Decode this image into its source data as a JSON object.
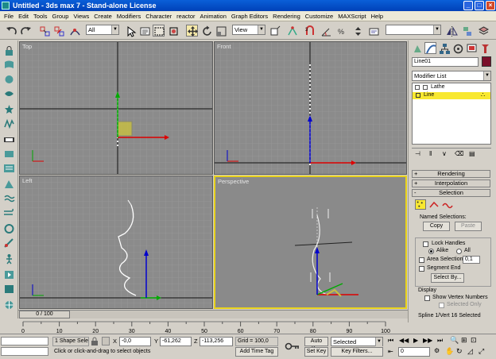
{
  "window": {
    "title": "Untitled - 3ds max 7 - Stand-alone License"
  },
  "menu": [
    "File",
    "Edit",
    "Tools",
    "Group",
    "Views",
    "Create",
    "Modifiers",
    "Character",
    "reactor",
    "Animation",
    "Graph Editors",
    "Rendering",
    "Customize",
    "MAXScript",
    "Help"
  ],
  "toolbar": {
    "selection_filter": "All",
    "reference_coord": "View"
  },
  "viewports": {
    "top": "Top",
    "front": "Front",
    "left": "Left",
    "perspective": "Perspective"
  },
  "panel": {
    "object_name": "Line01",
    "object_color": "#7a0f2a",
    "modifier_list": "Modifier List",
    "stack": [
      {
        "label": "Lathe",
        "selected": false
      },
      {
        "label": "Line",
        "selected": true
      }
    ],
    "rollouts": {
      "rendering": "Rendering",
      "interpolation": "Interpolation",
      "selection": "Selection"
    },
    "named_selections": "Named Selections:",
    "copy": "Copy",
    "paste": "Paste",
    "lock_handles": "Lock Handles",
    "alike": "Alike",
    "all": "All",
    "area_selection": "Area Selection:",
    "area_value": "0,1",
    "segment_end": "Segment End",
    "select_by": "Select By...",
    "display": "Display",
    "show_vertex_numbers": "Show Vertex Numbers",
    "selected_only": "Selected Only",
    "spline_status": "Spline 1/Vert 16 Selected"
  },
  "timeline": {
    "frame": "0 / 100",
    "ticks": [
      "0",
      "10",
      "20",
      "30",
      "40",
      "50",
      "60",
      "70",
      "80",
      "90",
      "100"
    ]
  },
  "status": {
    "shape_sel": "1 Shape Sele",
    "x_label": "X",
    "x_value": "-0,0",
    "y_label": "Y",
    "y_value": "-61,262",
    "z_label": "Z",
    "z_value": "-113,256",
    "grid": "Grid = 100,0",
    "prompt": "Click or click-and-drag to select objects",
    "add_time_tag": "Add Time Tag",
    "auto_key": "Auto Key",
    "set_key": "Set Key",
    "key_mode": "Selected",
    "key_filters": "Key Filters...",
    "current_frame": "0"
  }
}
